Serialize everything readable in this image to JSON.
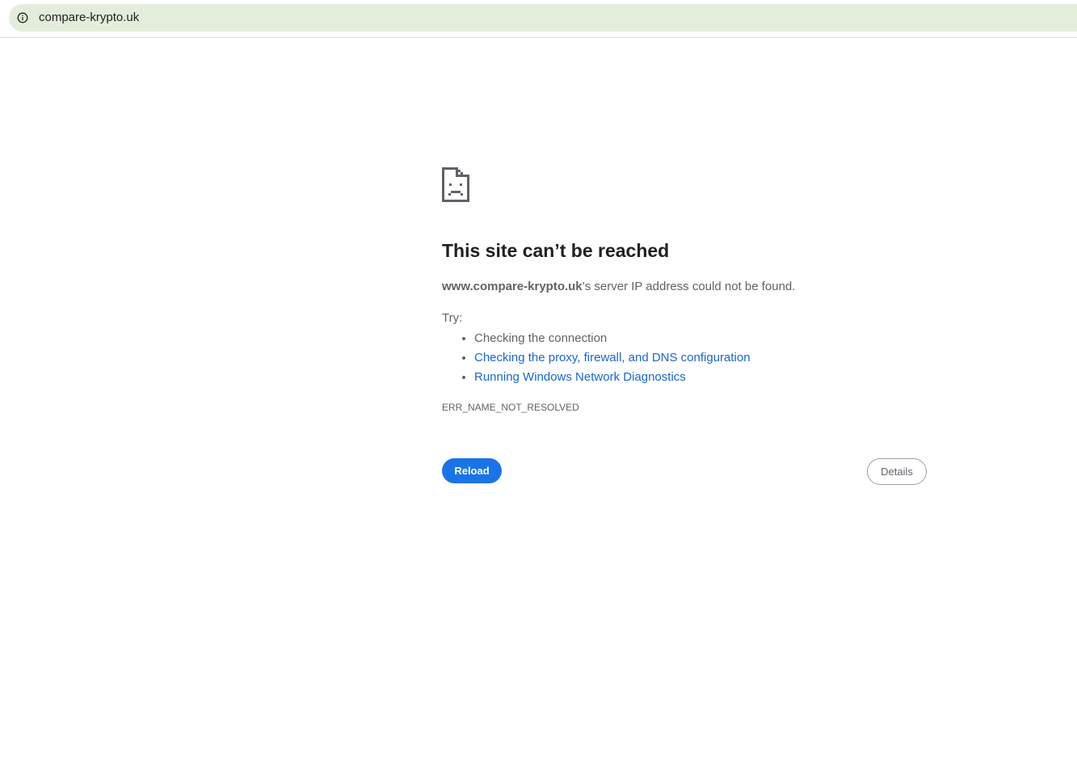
{
  "browser": {
    "url": "compare-krypto.uk",
    "info_icon": "info-icon"
  },
  "error_page": {
    "icon": "sad-page-icon",
    "title": "This site can’t be reached",
    "host": "www.compare-krypto.uk",
    "summary_suffix": "’s server IP address could not be found.",
    "try_label": "Try:",
    "suggestions": [
      "Checking the connection",
      "Checking the proxy, firewall, and DNS configuration",
      "Running Windows Network Diagnostics"
    ],
    "error_code": "ERR_NAME_NOT_RESOLVED",
    "reload_label": "Reload",
    "details_label": "Details"
  },
  "colors": {
    "omnibox_bg": "#e4eddb",
    "link": "#1967d2",
    "primary_button": "#1a73e8",
    "text": "#5f6368",
    "title": "#202124"
  }
}
